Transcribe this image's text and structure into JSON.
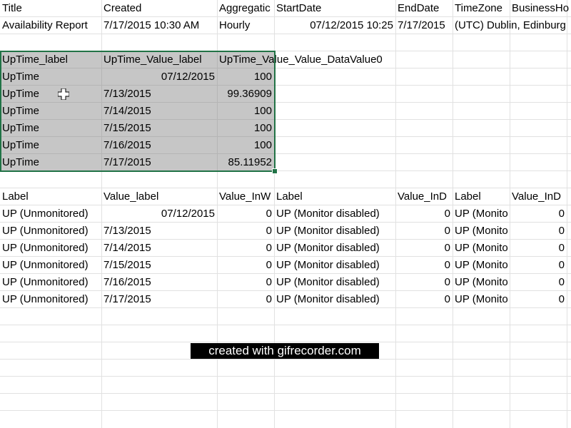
{
  "header_row": {
    "title": "Title",
    "created": "Created",
    "aggregation": "Aggregatic",
    "start_date": "StartDate",
    "end_date": "EndDate",
    "time_zone": "TimeZone",
    "business_hours": "BusinessHo"
  },
  "report_row": {
    "title": "Availability Report",
    "created": "7/17/2015 10:30 AM",
    "aggregation": "Hourly",
    "start_date": "07/12/2015 10:25",
    "end_date": "7/17/2015",
    "time_zone": "(UTC) Dublin, Edinburg"
  },
  "uptime_table": {
    "headers": [
      "UpTime_label",
      "UpTime_Value_label",
      "UpTime_Value_Value_DataValue0"
    ],
    "rows": [
      [
        "UpTime",
        "07/12/2015",
        "100"
      ],
      [
        "UpTime",
        "7/13/2015",
        "99.36909"
      ],
      [
        "UpTime",
        "7/14/2015",
        "100"
      ],
      [
        "UpTime",
        "7/15/2015",
        "100"
      ],
      [
        "UpTime",
        "7/16/2015",
        "100"
      ],
      [
        "UpTime",
        "7/17/2015",
        "85.11952"
      ]
    ]
  },
  "state_table": {
    "headers": [
      "Label",
      "Value_label",
      "Value_InW",
      "Label",
      "Value_InD",
      "Label",
      "Value_InD"
    ],
    "rows": [
      [
        "UP (Unmonitored)",
        "07/12/2015",
        "0",
        "UP (Monitor disabled)",
        "0",
        "UP (Monito",
        "0"
      ],
      [
        "UP (Unmonitored)",
        "7/13/2015",
        "0",
        "UP (Monitor disabled)",
        "0",
        "UP (Monito",
        "0"
      ],
      [
        "UP (Unmonitored)",
        "7/14/2015",
        "0",
        "UP (Monitor disabled)",
        "0",
        "UP (Monito",
        "0"
      ],
      [
        "UP (Unmonitored)",
        "7/15/2015",
        "0",
        "UP (Monitor disabled)",
        "0",
        "UP (Monito",
        "0"
      ],
      [
        "UP (Unmonitored)",
        "7/16/2015",
        "0",
        "UP (Monitor disabled)",
        "0",
        "UP (Monito",
        "0"
      ],
      [
        "UP (Unmonitored)",
        "7/17/2015",
        "0",
        "UP (Monitor disabled)",
        "0",
        "UP (Monito",
        "0"
      ]
    ]
  },
  "watermark": "created with gifrecorder.com",
  "colors": {
    "selection_fill": "#c6c6c6",
    "selection_border": "#217346",
    "gridline": "#e1e1e1"
  },
  "cursor_icon": "excel-cell-cursor-icon"
}
